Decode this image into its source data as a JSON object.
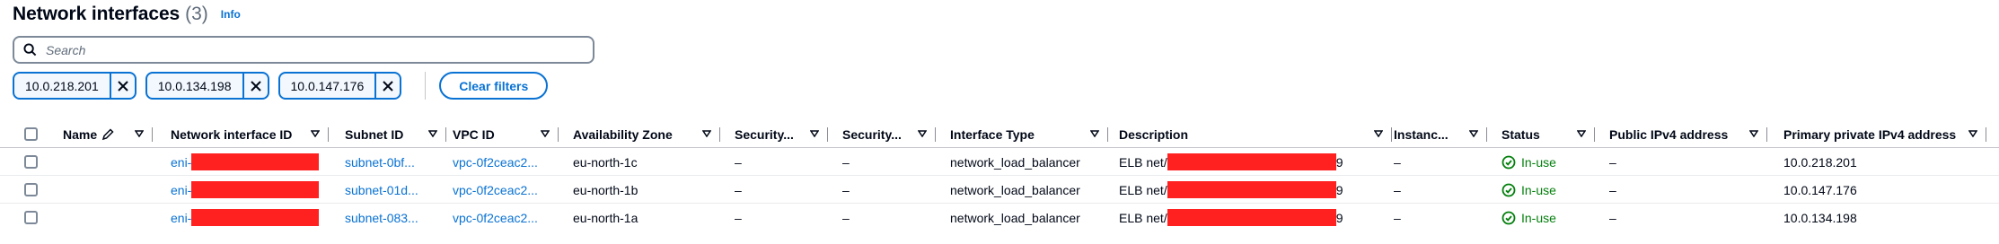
{
  "header": {
    "title": "Network interfaces",
    "count": "(3)",
    "info": "Info"
  },
  "search": {
    "placeholder": "Search"
  },
  "filters": {
    "tokens": [
      "10.0.218.201",
      "10.0.134.198",
      "10.0.147.176"
    ],
    "clear_label": "Clear filters"
  },
  "table": {
    "columns": [
      "Name",
      "Network interface ID",
      "Subnet ID",
      "VPC ID",
      "Availability Zone",
      "Security...",
      "Security...",
      "Interface Type",
      "Description",
      "Instanc...",
      "Status",
      "Public IPv4 address",
      "Primary private IPv4 address"
    ],
    "rows": [
      {
        "eni_prefix": "eni-",
        "subnet": "subnet-0bf...",
        "vpc": "vpc-0f2ceac2...",
        "az": "eu-north-1c",
        "sg1": "–",
        "sg2": "–",
        "type": "network_load_balancer",
        "desc_prefix": "ELB net/",
        "desc_suffix": "9",
        "instance": "–",
        "status": "In-use",
        "public_ip": "–",
        "private_ip": "10.0.218.201"
      },
      {
        "eni_prefix": "eni-",
        "subnet": "subnet-01d...",
        "vpc": "vpc-0f2ceac2...",
        "az": "eu-north-1b",
        "sg1": "–",
        "sg2": "–",
        "type": "network_load_balancer",
        "desc_prefix": "ELB net/",
        "desc_suffix": "9",
        "instance": "–",
        "status": "In-use",
        "public_ip": "–",
        "private_ip": "10.0.147.176"
      },
      {
        "eni_prefix": "eni-",
        "subnet": "subnet-083...",
        "vpc": "vpc-0f2ceac2...",
        "az": "eu-north-1a",
        "sg1": "–",
        "sg2": "–",
        "type": "network_load_balancer",
        "desc_prefix": "ELB net/",
        "desc_suffix": "9",
        "instance": "–",
        "status": "In-use",
        "public_ip": "–",
        "private_ip": "10.0.134.198"
      }
    ]
  },
  "colors": {
    "link": "#0972d3",
    "success": "#037f0c",
    "redaction": "#ff2020",
    "border": "#7d8998"
  },
  "icons": {
    "search": "search-icon",
    "dismiss": "close-icon",
    "edit": "pencil-icon",
    "sort": "caret-down-icon",
    "status": "check-circle-icon"
  }
}
